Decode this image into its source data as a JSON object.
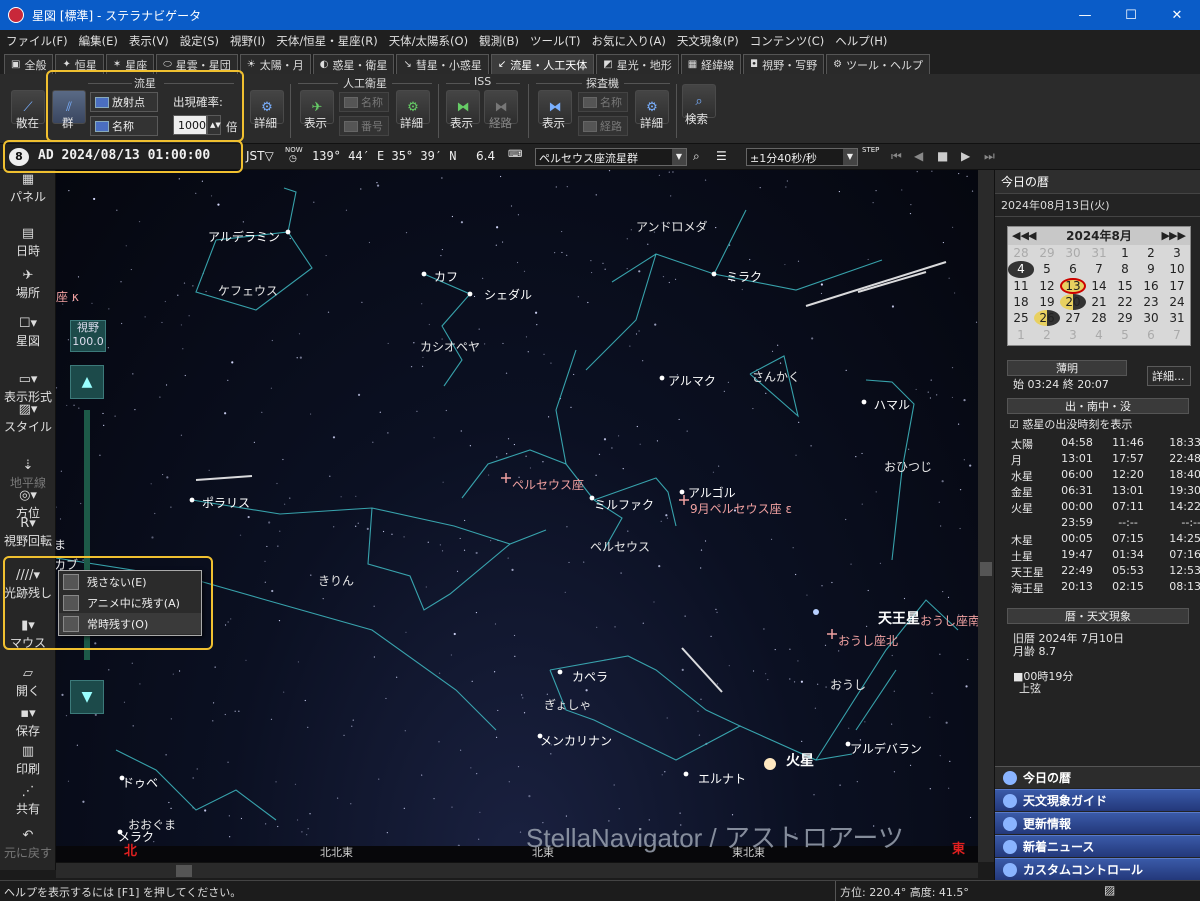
{
  "window": {
    "title": "星図 [標準] - ステラナビゲータ",
    "minimize": "—",
    "maximize": "☐",
    "close": "✕"
  },
  "menu": [
    "ファイル(F)",
    "編集(E)",
    "表示(V)",
    "設定(S)",
    "視野(I)",
    "天体/恒星・星座(R)",
    "天体/太陽系(O)",
    "観測(B)",
    "ツール(T)",
    "お気に入り(A)",
    "天文現象(P)",
    "コンテンツ(C)",
    "ヘルプ(H)"
  ],
  "tabs": [
    {
      "label": "全般",
      "icon": "▣"
    },
    {
      "label": "恒星",
      "icon": "✦"
    },
    {
      "label": "星座",
      "icon": "✶"
    },
    {
      "label": "星雲・星団",
      "icon": "⬭"
    },
    {
      "label": "太陽・月",
      "icon": "☀"
    },
    {
      "label": "惑星・衛星",
      "icon": "◐"
    },
    {
      "label": "彗星・小惑星",
      "icon": "↘"
    },
    {
      "label": "流星・人工天体",
      "icon": "↙"
    },
    {
      "label": "星光・地形",
      "icon": "◩"
    },
    {
      "label": "経緯線",
      "icon": "▦"
    },
    {
      "label": "視野・写野",
      "icon": "◘"
    },
    {
      "label": "ツール・ヘルプ",
      "icon": "⚙"
    }
  ],
  "toolbar": {
    "meteor_group": "流星",
    "scatter": "散在",
    "shower": "群",
    "radiant": "放射点",
    "name": "名称",
    "rate_label": "出現確率:",
    "rate_value": "1000",
    "rate_unit": "倍",
    "detail": "詳細",
    "satellite_group": "人工衛星",
    "show": "表示",
    "sat_name": "名称",
    "sat_number": "番号",
    "iss_group": "ISS",
    "route": "経路",
    "probe_group": "探査機",
    "probe_name": "名称",
    "probe_route": "経路",
    "search": "検索"
  },
  "statusline": {
    "datetime": "AD 2024/08/13 01:00:00",
    "tz": "JST▽",
    "now": "NOW",
    "coords": "139° 44′ E  35° 39′ N",
    "altitude": "6.4",
    "target": "ペルセウス座流星群",
    "speed": "±1分40秒/秒",
    "step": "STEP"
  },
  "leftpanel": [
    {
      "label": "パネル",
      "icon": "▦"
    },
    {
      "label": "日時",
      "icon": "▤"
    },
    {
      "label": "場所",
      "icon": "✈"
    },
    {
      "label": "星図",
      "icon": "☐▾"
    },
    {
      "label": "表示形式",
      "icon": "▭▾"
    },
    {
      "label": "スタイル",
      "icon": "▨▾"
    },
    {
      "label": "地平線",
      "icon": "⇣"
    },
    {
      "label": "方位",
      "icon": "◎▾"
    },
    {
      "label": "視野回転",
      "icon": "R▾"
    },
    {
      "label": "光跡残し",
      "icon": "////▾"
    },
    {
      "label": "マウス",
      "icon": "▮▾"
    },
    {
      "label": "開く",
      "icon": "▱"
    },
    {
      "label": "保存",
      "icon": "▪▾"
    },
    {
      "label": "印刷",
      "icon": "▥"
    },
    {
      "label": "共有",
      "icon": "⋰"
    },
    {
      "label": "元に戻す",
      "icon": "↶"
    }
  ],
  "fov": {
    "label": "視野",
    "value": "100.0"
  },
  "trail_menu": [
    "残さない(E)",
    "アニメ中に残す(A)",
    "常時残す(O)"
  ],
  "sky": {
    "constellations": [
      {
        "name": "ケフェウス"
      },
      {
        "name": "カシオペヤ"
      },
      {
        "name": "アンドロメダ"
      },
      {
        "name": "さんかく"
      },
      {
        "name": "おひつじ"
      },
      {
        "name": "ペルセウス"
      },
      {
        "name": "きりん"
      },
      {
        "name": "ぎょしゃ"
      },
      {
        "name": "おうし"
      },
      {
        "name": "おおぐま"
      }
    ],
    "stars": [
      {
        "name": "アルデラミン"
      },
      {
        "name": "カフ"
      },
      {
        "name": "シェダル"
      },
      {
        "name": "ミラク"
      },
      {
        "name": "アルマク"
      },
      {
        "name": "ハマル"
      },
      {
        "name": "ポラリス"
      },
      {
        "name": "ミルファク"
      },
      {
        "name": "アルゴル"
      },
      {
        "name": "カペラ"
      },
      {
        "name": "メンカリナン"
      },
      {
        "name": "エルナト"
      },
      {
        "name": "アルデバラン"
      },
      {
        "name": "ドゥベ"
      },
      {
        "name": "メラク"
      }
    ],
    "showers": [
      "ペルセウス座",
      "9月ペルセウス座 ε",
      "おうし座北",
      "おうし座南",
      "座 κ"
    ],
    "planets": [
      "天王星",
      "火星"
    ],
    "directions": [
      "北北東",
      "北東",
      "東北東"
    ],
    "direction_marks": [
      "北",
      "東"
    ],
    "watermark": "StellaNavigator / アストロアーツ",
    "left_partial": [
      "ま",
      "カブ"
    ]
  },
  "rightpanel": {
    "title": "今日の暦",
    "date": "2024年08月13日(火)",
    "calendar": {
      "header": "2024年8月",
      "weeks": [
        [
          "28",
          "29",
          "30",
          "31",
          "1",
          "2",
          "3"
        ],
        [
          "4",
          "5",
          "6",
          "7",
          "8",
          "9",
          "10"
        ],
        [
          "11",
          "12",
          "13",
          "14",
          "15",
          "16",
          "17"
        ],
        [
          "18",
          "19",
          "20",
          "21",
          "22",
          "23",
          "24"
        ],
        [
          "25",
          "26",
          "27",
          "28",
          "29",
          "30",
          "31"
        ],
        [
          "1",
          "2",
          "3",
          "4",
          "5",
          "6",
          "7"
        ]
      ]
    },
    "twilight_title": "薄明",
    "twilight": "始 03:24  終 20:07",
    "detail_button": "詳細...",
    "rise_title": "出・南中・没",
    "rise_check": "惑星の出没時刻を表示",
    "rise_table": [
      [
        "太陽",
        "04:58",
        "11:46",
        "18:33"
      ],
      [
        "月",
        "13:01",
        "17:57",
        "22:48"
      ],
      [
        "水星",
        "06:00",
        "12:20",
        "18:40"
      ],
      [
        "金星",
        "06:31",
        "13:01",
        "19:30"
      ],
      [
        "火星",
        "00:00",
        "07:11",
        "14:22"
      ],
      [
        "",
        "23:59",
        "--:--",
        "--:--"
      ],
      [
        "木星",
        "00:05",
        "07:15",
        "14:25"
      ],
      [
        "土星",
        "19:47",
        "01:34",
        "07:16"
      ],
      [
        "天王星",
        "22:49",
        "05:53",
        "12:53"
      ],
      [
        "海王星",
        "20:13",
        "02:15",
        "08:13"
      ]
    ],
    "calendar_title": "暦・天文現象",
    "lunar_date": "旧暦 2024年 7月10日",
    "moon_age": "月齢 8.7",
    "moon_phase_time": "00時19分",
    "moon_phase": "上弦",
    "nav": [
      "今日の暦",
      "天文現象ガイド",
      "更新情報",
      "新着ニュース",
      "カスタムコントロール"
    ]
  },
  "statusbar": {
    "help": "ヘルプを表示するには [F1] を押してください。",
    "direction": "方位: 220.4°  高度: 41.5°"
  }
}
